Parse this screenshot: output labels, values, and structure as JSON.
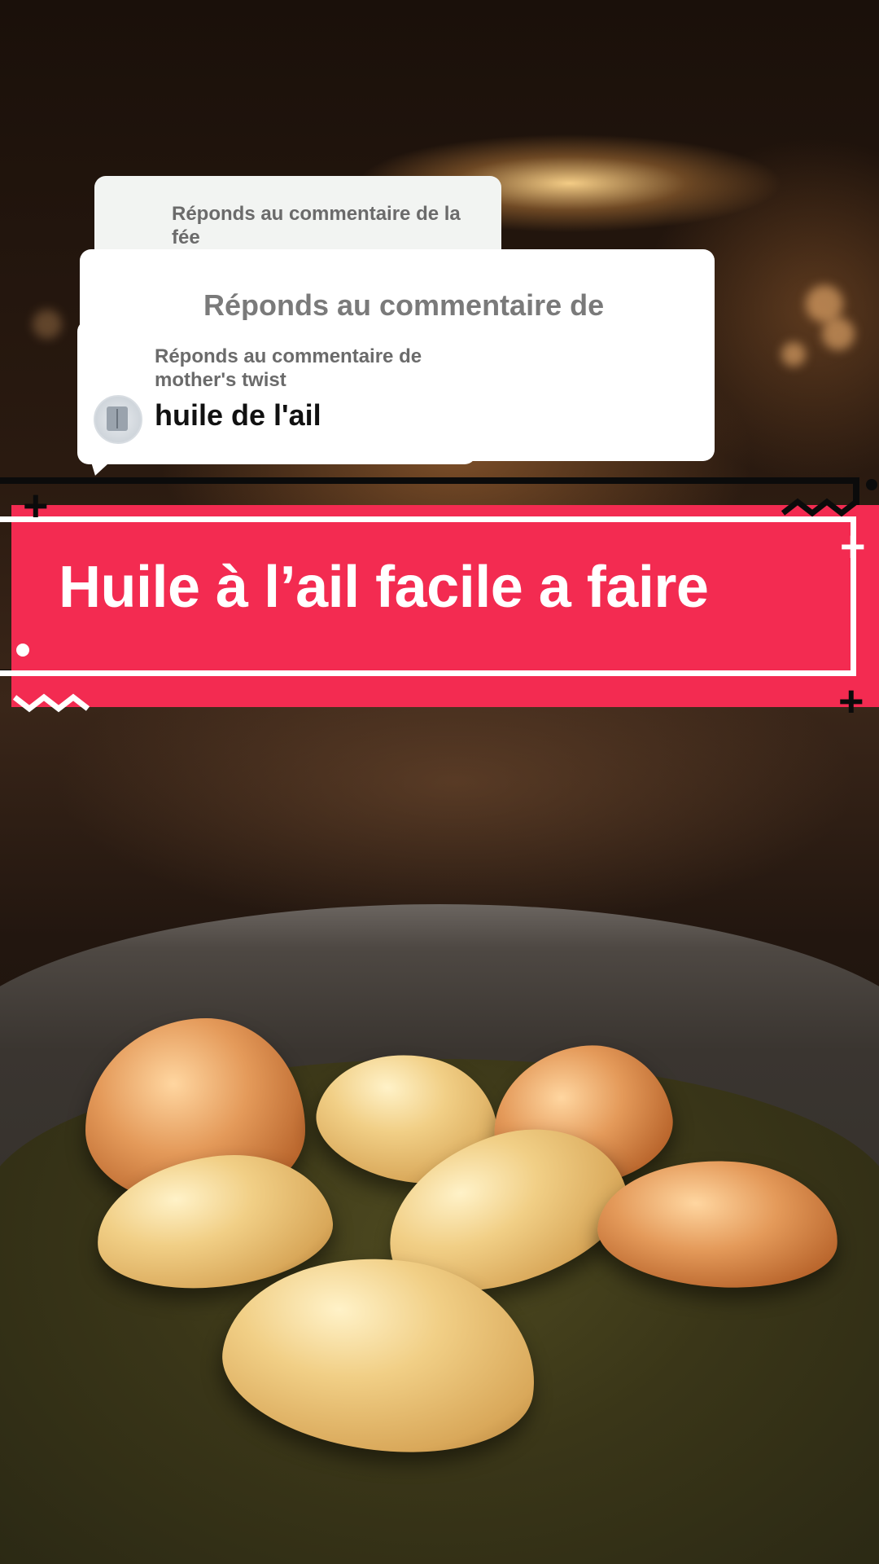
{
  "replies": [
    {
      "label": "Réponds au commentaire de la fée"
    },
    {
      "label": "Réponds au commentaire de"
    },
    {
      "label": "Réponds au commentaire de mother's twist",
      "comment": "huile de l'ail"
    }
  ],
  "title": "Huile à l’ail facile a faire",
  "colors": {
    "banner": "#f32b51",
    "text": "#ffffff",
    "frame": "#0b0b0b"
  }
}
